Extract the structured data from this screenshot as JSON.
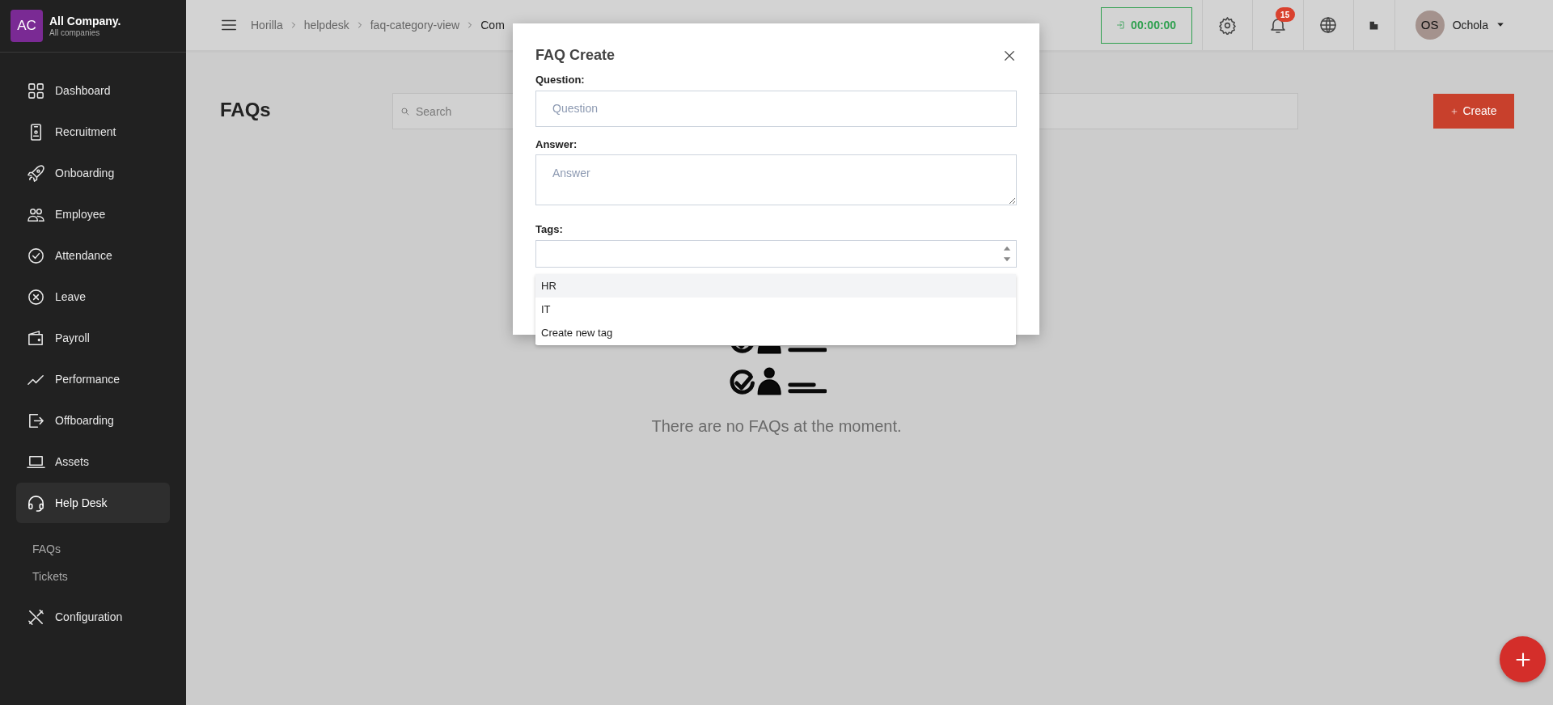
{
  "company": {
    "initials": "AC",
    "name": "All Company.",
    "subtitle": "All companies"
  },
  "sidebar": {
    "items": [
      {
        "label": "Dashboard",
        "kind": "dashboard",
        "selected": false
      },
      {
        "label": "Recruitment",
        "kind": "recruitment",
        "selected": false
      },
      {
        "label": "Onboarding",
        "kind": "onboarding",
        "selected": false
      },
      {
        "label": "Employee",
        "kind": "employee",
        "selected": false
      },
      {
        "label": "Attendance",
        "kind": "attendance",
        "selected": false
      },
      {
        "label": "Leave",
        "kind": "leave",
        "selected": false
      },
      {
        "label": "Payroll",
        "kind": "payroll",
        "selected": false
      },
      {
        "label": "Performance",
        "kind": "performance",
        "selected": false
      },
      {
        "label": "Offboarding",
        "kind": "offboarding",
        "selected": false
      },
      {
        "label": "Assets",
        "kind": "assets",
        "selected": false
      },
      {
        "label": "Help Desk",
        "kind": "helpdesk",
        "selected": true,
        "children": [
          {
            "label": "FAQs"
          },
          {
            "label": "Tickets"
          }
        ]
      },
      {
        "label": "Configuration",
        "kind": "configuration",
        "selected": false
      }
    ]
  },
  "breadcrumb": [
    "Horilla",
    "helpdesk",
    "faq-category-view",
    "Com"
  ],
  "topbar": {
    "timer": "00:00:00",
    "notification_count": "15",
    "user": {
      "initials": "OS",
      "name": "Ochola"
    }
  },
  "page": {
    "title": "FAQs",
    "search": {
      "placeholder": "Search"
    },
    "create_button": "Create"
  },
  "empty_state": {
    "message": "There are no FAQs at the moment."
  },
  "modal": {
    "title": "FAQ Create",
    "fields": [
      {
        "label": "Question:",
        "kind": "text",
        "placeholder": "Question"
      },
      {
        "label": "Answer:",
        "kind": "textarea",
        "placeholder": "Answer"
      },
      {
        "label": "Tags:",
        "kind": "select"
      }
    ],
    "dropdown": {
      "options": [
        {
          "label": "HR",
          "selected": true
        },
        {
          "label": "IT",
          "selected": false
        },
        {
          "label": "Create new tag",
          "selected": false
        }
      ]
    }
  }
}
